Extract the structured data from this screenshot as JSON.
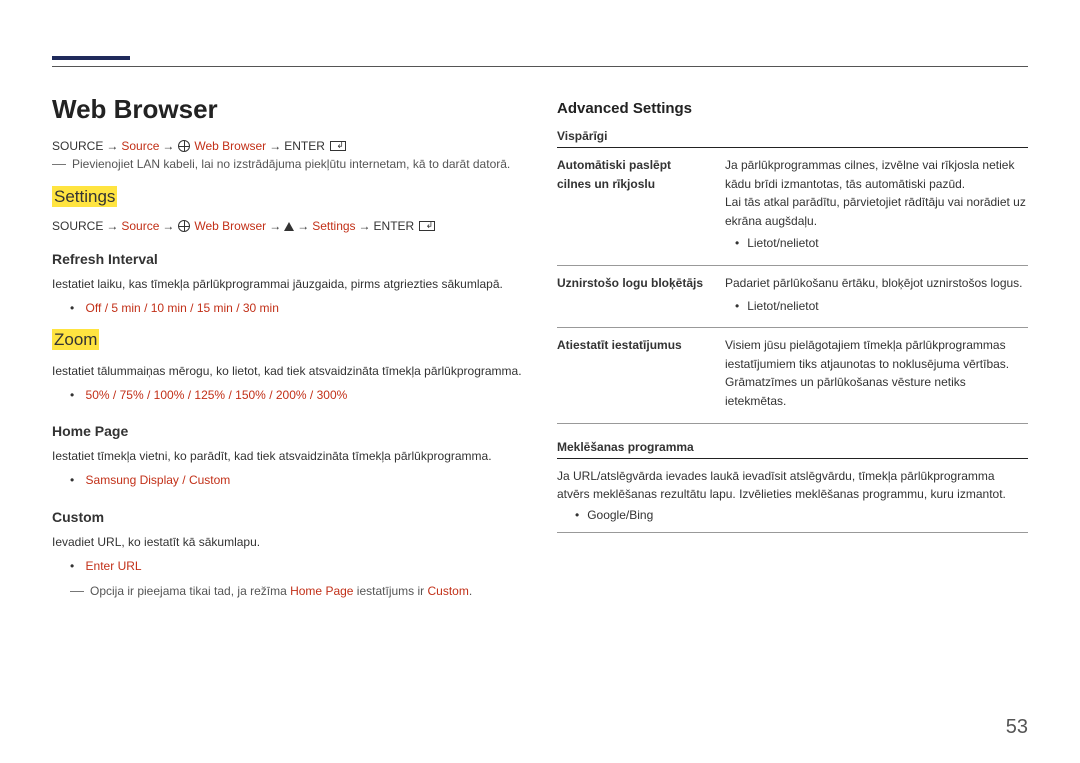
{
  "page_number": "53",
  "left": {
    "title": "Web Browser",
    "bc1": {
      "source": "SOURCE",
      "s2": "Source",
      "wb": "Web Browser",
      "enter": "ENTER"
    },
    "note1": "Pievienojiet LAN kabeli, lai no izstrādājuma piekļūtu internetam, kā to darāt datorā.",
    "settings_heading": "Settings",
    "bc2": {
      "source": "SOURCE",
      "s2": "Source",
      "wb": "Web Browser",
      "settings": "Settings",
      "enter": "ENTER"
    },
    "refresh": {
      "heading": "Refresh Interval",
      "desc": "Iestatiet laiku, kas tīmekļa pārlūkprogrammai jāuzgaida, pirms atgriezties sākumlapā.",
      "options": [
        "Off",
        "5 min",
        "10 min",
        "15 min",
        "30 min"
      ]
    },
    "zoom": {
      "heading": "Zoom",
      "desc": "Iestatiet tālummaiņas mērogu, ko lietot, kad tiek atsvaidzināta tīmekļa pārlūkprogramma.",
      "options": [
        "50%",
        "75%",
        "100%",
        "125%",
        "150%",
        "200%",
        "300%"
      ]
    },
    "home": {
      "heading": "Home Page",
      "desc": "Iestatiet tīmekļa vietni, ko parādīt, kad tiek atsvaidzināta tīmekļa pārlūkprogramma.",
      "options": [
        "Samsung Display",
        "Custom"
      ]
    },
    "custom": {
      "heading": "Custom",
      "desc": "Ievadiet URL, ko iestatīt kā sākumlapu.",
      "option": "Enter URL",
      "fn_pre": "Opcija ir pieejama tikai tad, ja režīma ",
      "fn_hp": "Home Page",
      "fn_mid": " iestatījums ir ",
      "fn_cust": "Custom",
      "fn_end": "."
    }
  },
  "right": {
    "heading": "Advanced Settings",
    "group1": "Vispārīgi",
    "row1": {
      "label": "Automātiski paslēpt cilnes un rīkjoslu",
      "text": "Ja pārlūkprogrammas cilnes, izvēlne vai rīkjosla netiek kādu brīdi izmantotas, tās automātiski pazūd.\nLai tās atkal parādītu, pārvietojiet rādītāju vai norādiet uz ekrāna augšdaļu.",
      "bullet": "Lietot/nelietot"
    },
    "row2": {
      "label": "Uznirstošo logu bloķētājs",
      "text": "Padariet pārlūkošanu ērtāku, bloķējot uznirstošos logus.",
      "bullet": "Lietot/nelietot"
    },
    "row3": {
      "label": "Atiestatīt iestatījumus",
      "text": "Visiem jūsu pielāgotajiem tīmekļa pārlūkprogrammas iestatījumiem tiks atjaunotas to noklusējuma vērtības. Grāmatzīmes un pārlūkošanas vēsture netiks ietekmētas."
    },
    "group2": "Meklēšanas programma",
    "search_desc": "Ja URL/atslēgvārda ievades laukā ievadīsit atslēgvārdu, tīmekļa pārlūkprogramma atvērs meklēšanas rezultātu lapu. Izvēlieties meklēšanas programmu, kuru izmantot.",
    "search_opt": "Google/Bing"
  }
}
